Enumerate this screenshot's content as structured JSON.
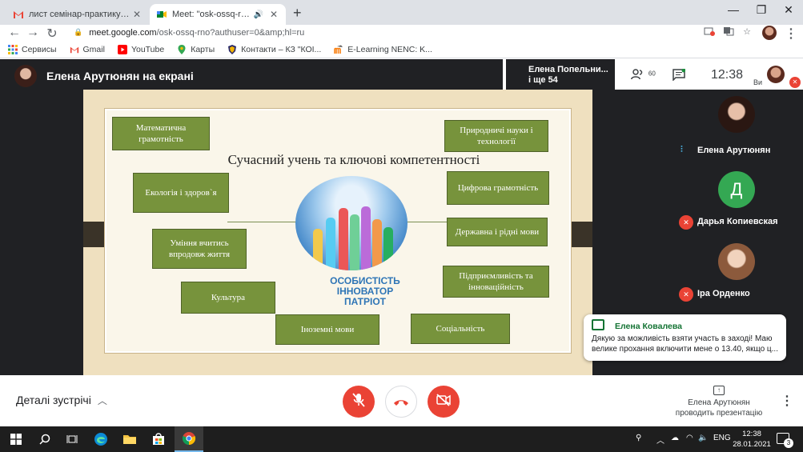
{
  "browser": {
    "tabs": [
      {
        "title": "лист семінар-практикум - swetl",
        "icon": "gmail-icon"
      },
      {
        "title": "Meet: \"osk-ossq-rno\"",
        "icon": "meet-icon",
        "active": true
      }
    ],
    "url_host": "meet.google.com",
    "url_path": "/osk-ossq-rno?authuser=0&amp;hl=ru",
    "bookmarks": [
      {
        "label": "Сервисы",
        "icon": "apps-icon",
        "color": "#4285f4"
      },
      {
        "label": "Gmail",
        "icon": "gmail-icon",
        "color": "#ea4335"
      },
      {
        "label": "YouTube",
        "icon": "youtube-icon",
        "color": "#ff0000"
      },
      {
        "label": "Карты",
        "icon": "maps-icon",
        "color": "#34a853"
      },
      {
        "label": "Контакти – КЗ \"КОІ...",
        "icon": "shield-icon",
        "color": "#f4b400"
      },
      {
        "label": "E-Learning NENC: K...",
        "icon": "moodle-icon",
        "color": "#f98012"
      }
    ]
  },
  "meet": {
    "presenter_label": "Елена Арутюнян на екрані",
    "people_note_line1": "Елена Попельни...",
    "people_note_line2": "і ще 54",
    "participants_count": "60",
    "time": "12:38",
    "you_label": "Ви",
    "participants": [
      {
        "name": "Елена Арутюнян",
        "speaking": true,
        "muted": false
      },
      {
        "name": "Дарья Копиевская",
        "initial": "Д",
        "muted": true,
        "color": "#34a853"
      },
      {
        "name": "Іра Орденко",
        "muted": true
      }
    ],
    "chat": {
      "sender": "Елена Ковалева",
      "message": "Дякую за можливість взяти участь в заході! Маю велике прохання включити мене о 13.40, якщо ц..."
    },
    "meeting_details_label": "Деталі зустрічі",
    "presenting_line1": "Елена Арутюнян",
    "presenting_line2": "проводить презентацію"
  },
  "slide": {
    "title": "Сучасний учень та ключові компетентності",
    "center_line1": "ОСОБИСТІСТЬ",
    "center_line2": "ІННОВАТОР",
    "center_line3": "ПАТРІОТ",
    "boxes": {
      "math": "Математична грамотність",
      "ecology": "Екологія і здоров`я",
      "lifelong": "Уміння вчитись впродовж життя",
      "culture": "Культура",
      "foreign": "Іноземні мови",
      "natural": "Природничі науки і технології",
      "digital": "Цифрова грамотність",
      "state": "Державна і рідні мови",
      "entrepreneur": "Підприємливість та інноваційність",
      "social": "Соціальність"
    },
    "box_color": "#77933c"
  },
  "taskbar": {
    "lang": "ENG",
    "time": "12:38",
    "date": "28.01.2021",
    "notifications": "3"
  }
}
